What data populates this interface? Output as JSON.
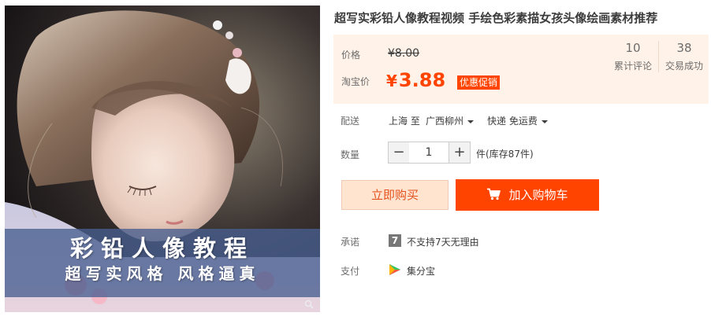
{
  "product": {
    "title": "超写实彩铅人像教程视频 手绘色彩素描女孩头像绘画素材推荐",
    "image": {
      "banner_title": "彩铅人像教程",
      "banner_subtitle": "超写实风格 风格逼真"
    }
  },
  "price": {
    "label": "价格",
    "original": "¥8.00",
    "promo_label": "淘宝价",
    "promo_currency": "¥",
    "promo_amount": "3.88",
    "promo_badge": "优惠促销",
    "accent_color": "#ff4400",
    "background_color": "#fff2e8"
  },
  "stats": {
    "reviews_count": "10",
    "reviews_label": "累计评论",
    "sales_count": "38",
    "sales_label": "交易成功"
  },
  "shipping": {
    "label": "配送",
    "from": "上海 至",
    "to": "广西柳州",
    "method": "快递 免运费"
  },
  "quantity": {
    "label": "数量",
    "minus": "−",
    "value": "1",
    "plus": "+",
    "stock": "件(库存87件)"
  },
  "actions": {
    "buy_now": "立即购买",
    "add_to_cart": "加入购物车"
  },
  "service": {
    "promise_label": "承诺",
    "promise_icon_text": "7",
    "promise_text": "不支持7天无理由",
    "payment_label": "支付",
    "payment_text": "集分宝"
  },
  "icons": {
    "cart": "cart-icon",
    "seven_day": "seven-day-icon",
    "payment": "jifenbao-icon",
    "zoom": "zoom-icon"
  }
}
